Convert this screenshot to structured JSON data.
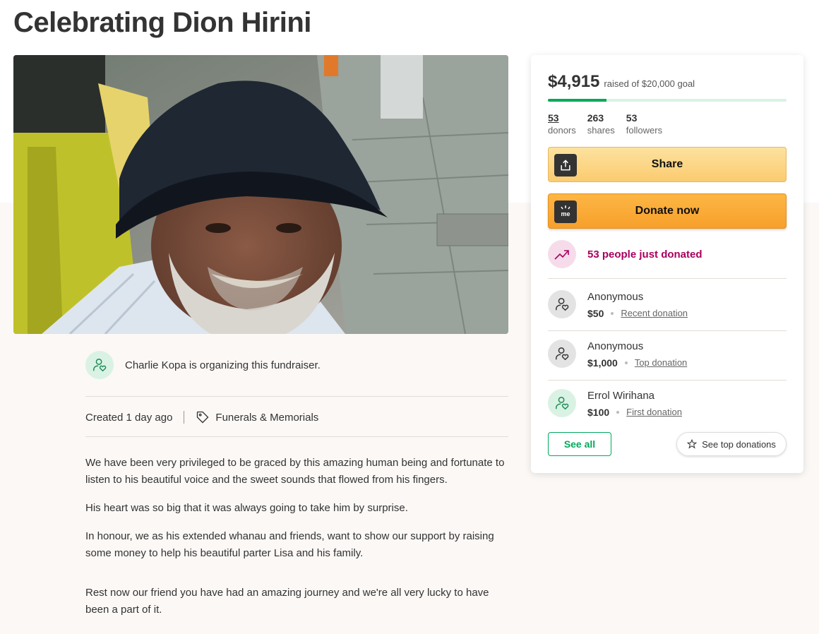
{
  "page": {
    "title": "Celebrating Dion Hirini"
  },
  "organizer": {
    "text": "Charlie Kopa is organizing this fundraiser."
  },
  "meta": {
    "created": "Created 1 day ago",
    "category": "Funerals & Memorials"
  },
  "story": [
    "We have been very privileged to be graced by this amazing human being and fortunate to listen to his beautiful voice and the sweet sounds that flowed from his fingers.",
    "His heart was so big that it was always going to take him by surprise.",
    "In honour, we as his extended whanau and friends, want to show our support by raising some money to help his beautiful parter Lisa and his family.",
    "Rest now our friend you have had an amazing journey and we're all very lucky to have been a part of it."
  ],
  "donation_card": {
    "raised": "$4,915",
    "goal_text": "raised of $20,000 goal",
    "progress_fraction": 0.2458,
    "stats": [
      {
        "value": "53",
        "label": "donors"
      },
      {
        "value": "263",
        "label": "shares"
      },
      {
        "value": "53",
        "label": "followers"
      }
    ],
    "share_label": "Share",
    "donate_label": "Donate now",
    "donate_icon_text": "me",
    "recent_activity": "53 people just donated",
    "donations": [
      {
        "name": "Anonymous",
        "amount": "$50",
        "kind": "Recent donation"
      },
      {
        "name": "Anonymous",
        "amount": "$1,000",
        "kind": "Top donation"
      },
      {
        "name": "Errol Wirihana",
        "amount": "$100",
        "kind": "First donation"
      }
    ],
    "see_all_label": "See all",
    "see_top_label": "See top donations"
  },
  "colors": {
    "brand_green": "#02a95c",
    "donate_orange": "#f7a02b",
    "share_yellow": "#fbcb70",
    "trend_magenta": "#a8005f"
  },
  "icons": {
    "share": "share-upload-icon",
    "donate": "gofundme-logo-icon",
    "trend": "trending-up-icon",
    "donor": "person-heart-icon",
    "tag": "tag-icon",
    "star": "star-icon"
  }
}
